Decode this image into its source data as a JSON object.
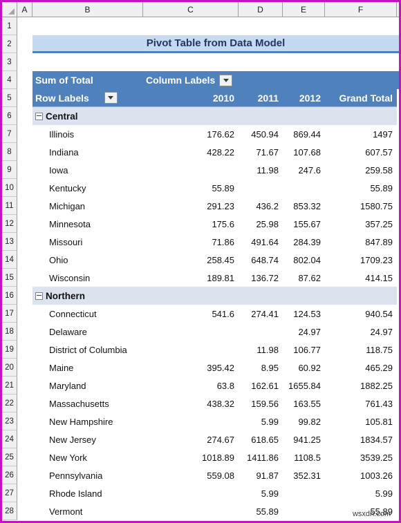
{
  "spreadsheet": {
    "column_headers": [
      "A",
      "B",
      "C",
      "D",
      "E",
      "F"
    ],
    "row_numbers": [
      "1",
      "2",
      "3",
      "4",
      "5",
      "6",
      "7",
      "8",
      "9",
      "10",
      "11",
      "12",
      "13",
      "14",
      "15",
      "16",
      "17",
      "18",
      "19",
      "20",
      "21",
      "22",
      "23",
      "24",
      "25",
      "26",
      "27",
      "28"
    ],
    "select_all_icon": "select-all-triangle",
    "watermark": "wsxdn.com"
  },
  "title": {
    "text": "Pivot Table from Data Model",
    "fill_color": "#C5D9F1",
    "text_color": "#1F3864",
    "underline_color": "#4F81BD"
  },
  "pivot": {
    "value_field_label": "Sum of Total",
    "column_labels": "Column Labels",
    "row_labels": "Row Labels",
    "column_filter_icon": "filter-dropdown-icon",
    "row_filter_icon": "filter-dropdown-icon",
    "header_fill": "#4F81BD",
    "header_text_color": "#FFFFFF",
    "group_band_fill": "#DCE3EF",
    "columns": [
      "2010",
      "2011",
      "2012",
      "Grand Total"
    ],
    "collapse_icon": "collapse-minus-icon",
    "groups": [
      {
        "name": "Central",
        "row": "6",
        "items": [
          {
            "row": "7",
            "label": "Illinois",
            "v2010": "176.62",
            "v2011": "450.94",
            "v2012": "869.44",
            "total": "1497"
          },
          {
            "row": "8",
            "label": "Indiana",
            "v2010": "428.22",
            "v2011": "71.67",
            "v2012": "107.68",
            "total": "607.57"
          },
          {
            "row": "9",
            "label": "Iowa",
            "v2010": "",
            "v2011": "11.98",
            "v2012": "247.6",
            "total": "259.58"
          },
          {
            "row": "10",
            "label": "Kentucky",
            "v2010": "55.89",
            "v2011": "",
            "v2012": "",
            "total": "55.89"
          },
          {
            "row": "11",
            "label": "Michigan",
            "v2010": "291.23",
            "v2011": "436.2",
            "v2012": "853.32",
            "total": "1580.75"
          },
          {
            "row": "12",
            "label": "Minnesota",
            "v2010": "175.6",
            "v2011": "25.98",
            "v2012": "155.67",
            "total": "357.25"
          },
          {
            "row": "13",
            "label": "Missouri",
            "v2010": "71.86",
            "v2011": "491.64",
            "v2012": "284.39",
            "total": "847.89"
          },
          {
            "row": "14",
            "label": "Ohio",
            "v2010": "258.45",
            "v2011": "648.74",
            "v2012": "802.04",
            "total": "1709.23"
          },
          {
            "row": "15",
            "label": "Wisconsin",
            "v2010": "189.81",
            "v2011": "136.72",
            "v2012": "87.62",
            "total": "414.15"
          }
        ]
      },
      {
        "name": "Northern",
        "row": "16",
        "items": [
          {
            "row": "17",
            "label": "Connecticut",
            "v2010": "541.6",
            "v2011": "274.41",
            "v2012": "124.53",
            "total": "940.54"
          },
          {
            "row": "18",
            "label": "Delaware",
            "v2010": "",
            "v2011": "",
            "v2012": "24.97",
            "total": "24.97"
          },
          {
            "row": "19",
            "label": "District of Columbia",
            "v2010": "",
            "v2011": "11.98",
            "v2012": "106.77",
            "total": "118.75"
          },
          {
            "row": "20",
            "label": "Maine",
            "v2010": "395.42",
            "v2011": "8.95",
            "v2012": "60.92",
            "total": "465.29"
          },
          {
            "row": "21",
            "label": "Maryland",
            "v2010": "63.8",
            "v2011": "162.61",
            "v2012": "1655.84",
            "total": "1882.25"
          },
          {
            "row": "22",
            "label": "Massachusetts",
            "v2010": "438.32",
            "v2011": "159.56",
            "v2012": "163.55",
            "total": "761.43"
          },
          {
            "row": "23",
            "label": "New Hampshire",
            "v2010": "",
            "v2011": "5.99",
            "v2012": "99.82",
            "total": "105.81"
          },
          {
            "row": "24",
            "label": "New Jersey",
            "v2010": "274.67",
            "v2011": "618.65",
            "v2012": "941.25",
            "total": "1834.57"
          },
          {
            "row": "25",
            "label": "New York",
            "v2010": "1018.89",
            "v2011": "1411.86",
            "v2012": "1108.5",
            "total": "3539.25"
          },
          {
            "row": "26",
            "label": "Pennsylvania",
            "v2010": "559.08",
            "v2011": "91.87",
            "v2012": "352.31",
            "total": "1003.26"
          },
          {
            "row": "27",
            "label": "Rhode Island",
            "v2010": "",
            "v2011": "5.99",
            "v2012": "",
            "total": "5.99"
          },
          {
            "row": "28",
            "label": "Vermont",
            "v2010": "",
            "v2011": "55.89",
            "v2012": "",
            "total": "55.89"
          }
        ]
      }
    ]
  }
}
